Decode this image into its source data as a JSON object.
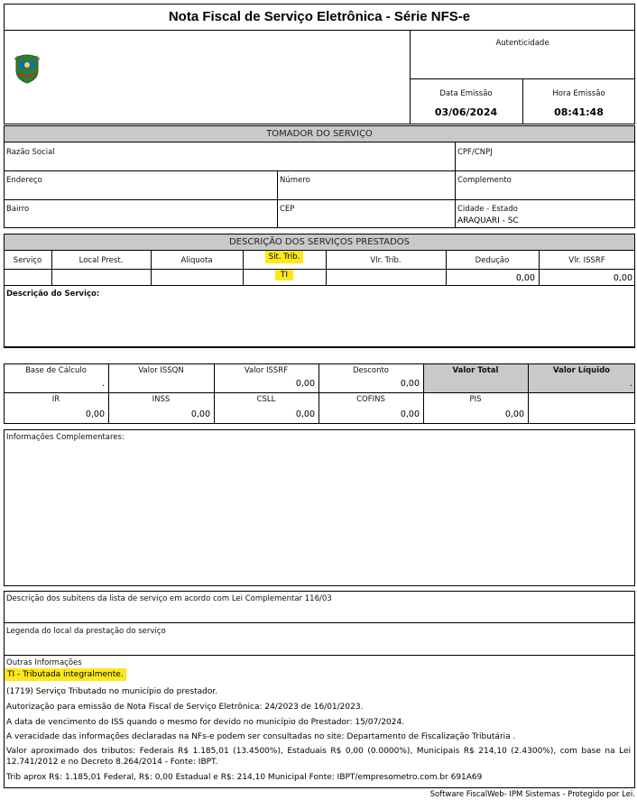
{
  "header": {
    "title": "Nota Fiscal de Serviço Eletrônica - Série NFS-e",
    "autenticidade_label": "Autenticidade",
    "data_emissao_label": "Data Emissão",
    "data_emissao": "03/06/2024",
    "hora_emissao_label": "Hora Emissão",
    "hora_emissao": "08:41:48"
  },
  "tomador": {
    "section_title": "TOMADOR DO SERVIÇO",
    "razao_social_label": "Razão Social",
    "cpf_cnpj_label": "CPF/CNPJ",
    "endereco_label": "Endereço",
    "numero_label": "Número",
    "complemento_label": "Complemento",
    "bairro_label": "Bairro",
    "cep_label": "CEP",
    "cidade_label": "Cidade - Estado",
    "cidade_value": "ARAQUARI - SC"
  },
  "servicos": {
    "section_title": "DESCRIÇÃO DOS SERVIÇOS PRESTADOS",
    "columns": [
      "Serviço",
      "Local Prest.",
      "Aliquota",
      "Sit. Trib.",
      "Vlr. Trib.",
      "Dedução",
      "Vlr. ISSRF"
    ],
    "row": {
      "sit_trib": "TI",
      "deducao": "0,00",
      "vlr_issrf": "0,00"
    },
    "descricao_label": "Descrição do Serviço:"
  },
  "valores": {
    "base_calculo_label": "Base de Cálculo",
    "base_calculo": ".",
    "valor_issqn_label": "Valor ISSQN",
    "valor_issrf_label": "Valor ISSRF",
    "valor_issrf": "0,00",
    "desconto_label": "Desconto",
    "desconto": "0,00",
    "valor_total_label": "Valor Total",
    "valor_liquido_label": "Valor Líquido",
    "valor_liquido": ".",
    "ir_label": "IR",
    "ir": "0,00",
    "inss_label": "INSS",
    "inss": "0,00",
    "csll_label": "CSLL",
    "csll": "0,00",
    "cofins_label": "COFINS",
    "cofins": "0,00",
    "pis_label": "PIS",
    "pis": "0,00"
  },
  "info_complementares_label": "Informações Complementares:",
  "subitens_label": "Descrição dos subitens da lista de serviço em acordo com Lei Complementar 116/03",
  "legenda_label": "Legenda do local da prestação do serviço",
  "outras": {
    "label": "Outras Informações",
    "lines": [
      "TI - Tributada integralmente.",
      "(1719) Serviço Tributado no município do prestador.",
      "Autorização para emissão de Nota Fiscal de Serviço Eletrônica: 24/2023 de 16/01/2023.",
      "A data de vencimento do ISS quando o mesmo for devido no município do Prestador: 15/07/2024.",
      "A veracidade das informações declaradas na NFs-e podem ser consultadas no site: Departamento de Fiscalização Tributária .",
      "Valor aproximado dos tributos: Federais R$ 1.185,01 (13.4500%), Estaduais R$ 0,00 (0.0000%), Municipais R$ 214,10 (2.4300%), com base na Lei 12.741/2012 e no Decreto 8.264/2014 - Fonte: IBPT.",
      "Trib aprox R$: 1.185,01 Federal, R$: 0,00 Estadual e R$: 214,10 Municipal Fonte: IBPT/empresometro.com.br 691A69"
    ]
  },
  "footer": "Software FiscalWeb- IPM Sistemas - Protegido por Lei.",
  "colors": {
    "highlight": "#ffe81a",
    "section_gray": "#c9c9c9"
  },
  "icons": {
    "logo": "municipal-coat-of-arms-icon"
  }
}
